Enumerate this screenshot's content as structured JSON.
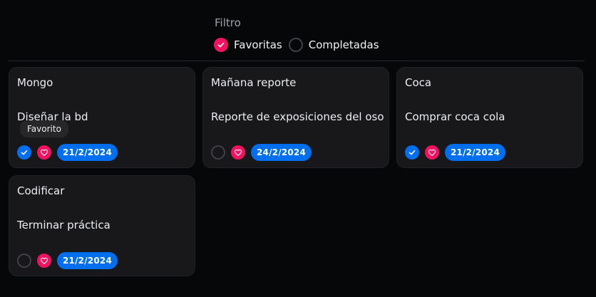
{
  "filter": {
    "title": "Filtro",
    "options": [
      {
        "label": "Favoritas",
        "checked": true
      },
      {
        "label": "Completadas",
        "checked": false
      }
    ]
  },
  "tooltip": {
    "text": "Favorito"
  },
  "cards": [
    {
      "title": "Mongo",
      "description": "Diseñar la bd",
      "completed": true,
      "favorite": true,
      "date": "21/2/2024"
    },
    {
      "title": "Mañana reporte",
      "description": "Reporte de exposiciones del oso",
      "completed": false,
      "favorite": true,
      "date": "24/2/2024"
    },
    {
      "title": "Coca",
      "description": "Comprar coca cola",
      "completed": true,
      "favorite": true,
      "date": "21/2/2024"
    },
    {
      "title": "Codificar",
      "description": "Terminar práctica",
      "completed": false,
      "favorite": true,
      "date": "21/2/2024"
    }
  ],
  "colors": {
    "background": "#050709",
    "card": "#18181b",
    "pink": "#f31260",
    "blue": "#006fee"
  },
  "icons": {
    "check": "check-icon",
    "heart": "heart-icon"
  }
}
